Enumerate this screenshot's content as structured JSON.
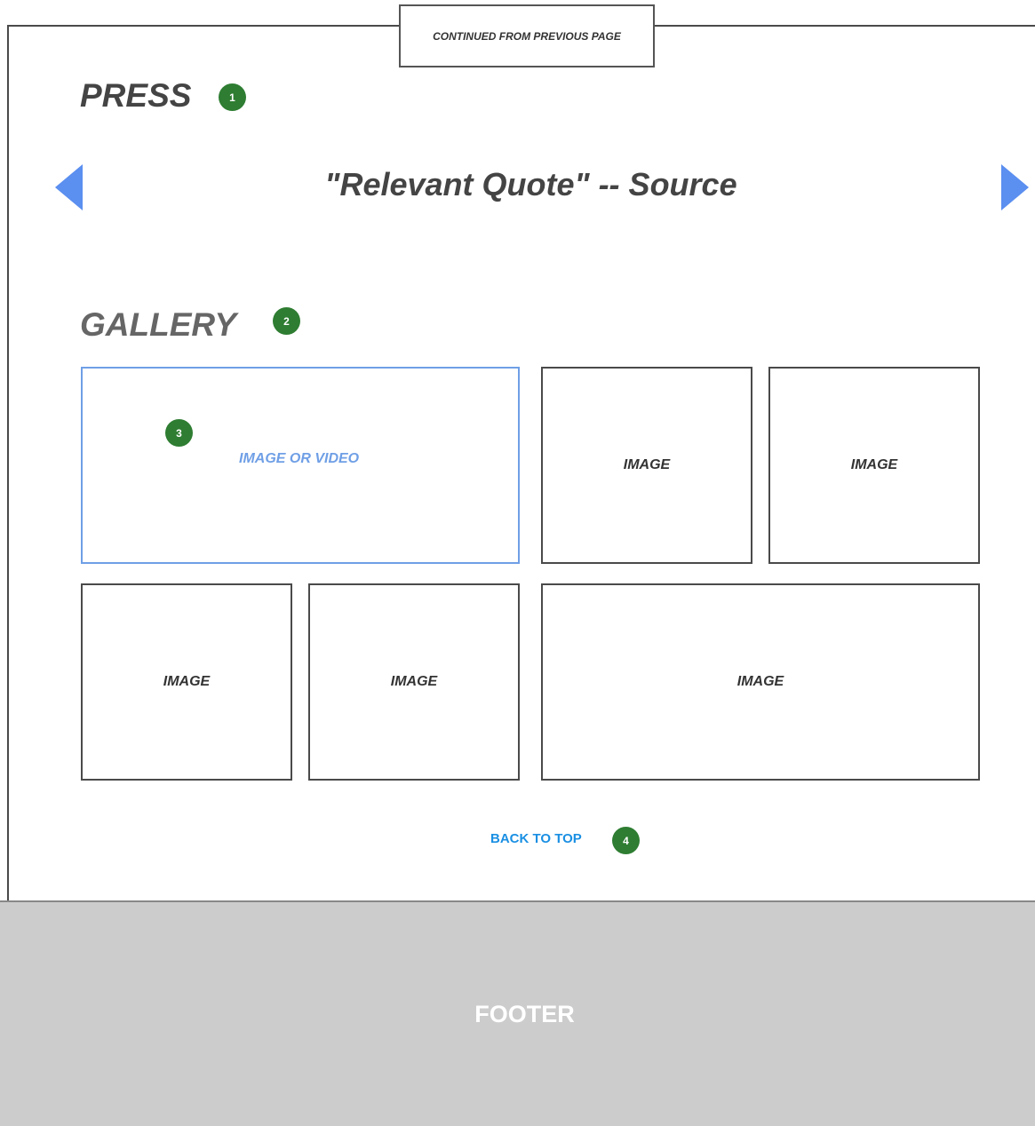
{
  "continued_label": "CONTINUED FROM PREVIOUS PAGE",
  "press": {
    "title": "PRESS",
    "badge": "1",
    "quote": "\"Relevant Quote\" -- Source"
  },
  "gallery": {
    "title": "GALLERY",
    "badge": "2",
    "featured_badge": "3",
    "tiles": [
      {
        "label": "IMAGE OR VIDEO"
      },
      {
        "label": "IMAGE"
      },
      {
        "label": "IMAGE"
      },
      {
        "label": "IMAGE"
      },
      {
        "label": "IMAGE"
      },
      {
        "label": "IMAGE"
      }
    ]
  },
  "back_to_top": {
    "label": "BACK TO TOP",
    "badge": "4"
  },
  "footer": {
    "label": "FOOTER"
  },
  "colors": {
    "badge": "#2e7d32",
    "arrow": "#5b8ff0",
    "link": "#1a8fe3",
    "footer_bg": "#cccccc"
  }
}
